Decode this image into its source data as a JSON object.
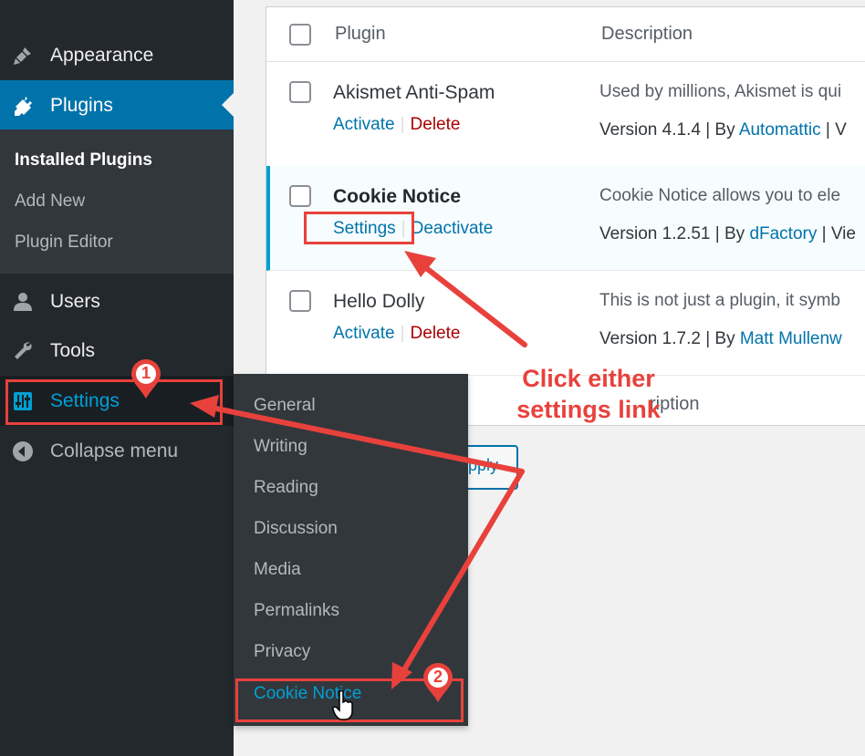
{
  "sidebar": {
    "appearance": "Appearance",
    "plugins": "Plugins",
    "submenu": [
      "Installed Plugins",
      "Add New",
      "Plugin Editor"
    ],
    "users": "Users",
    "tools": "Tools",
    "settings": "Settings",
    "collapse": "Collapse menu"
  },
  "flyout": [
    "General",
    "Writing",
    "Reading",
    "Discussion",
    "Media",
    "Permalinks",
    "Privacy",
    "Cookie Notice"
  ],
  "table": {
    "col_plugin": "Plugin",
    "col_description": "Description",
    "footer_description": "ription",
    "apply_label": "pply",
    "plugins": [
      {
        "name": "Akismet Anti-Spam",
        "action1": "Activate",
        "action2": "Delete",
        "description": "Used by millions, Akismet is qui",
        "version": "Version 4.1.4 | By ",
        "author": "Automattic",
        "tail": " | V"
      },
      {
        "name": "Cookie Notice",
        "action1": "Settings",
        "action2": "Deactivate",
        "description": "Cookie Notice allows you to ele",
        "version": "Version 1.2.51 | By ",
        "author": "dFactory",
        "tail": " | Vie"
      },
      {
        "name": "Hello Dolly",
        "action1": "Activate",
        "action2": "Delete",
        "description": "This is not just a plugin, it symb",
        "version": "Version 1.7.2 | By ",
        "author": "Matt Mullenw",
        "tail": ""
      }
    ]
  },
  "annotation": {
    "text": "Click either\nsettings link",
    "badge1": "1",
    "badge2": "2",
    "color": "#e8413c"
  },
  "icons": {
    "appearance": "brush-icon",
    "plugins": "plug-icon",
    "users": "user-icon",
    "tools": "wrench-icon",
    "settings": "sliders-icon",
    "collapse": "collapse-arrow-icon"
  }
}
